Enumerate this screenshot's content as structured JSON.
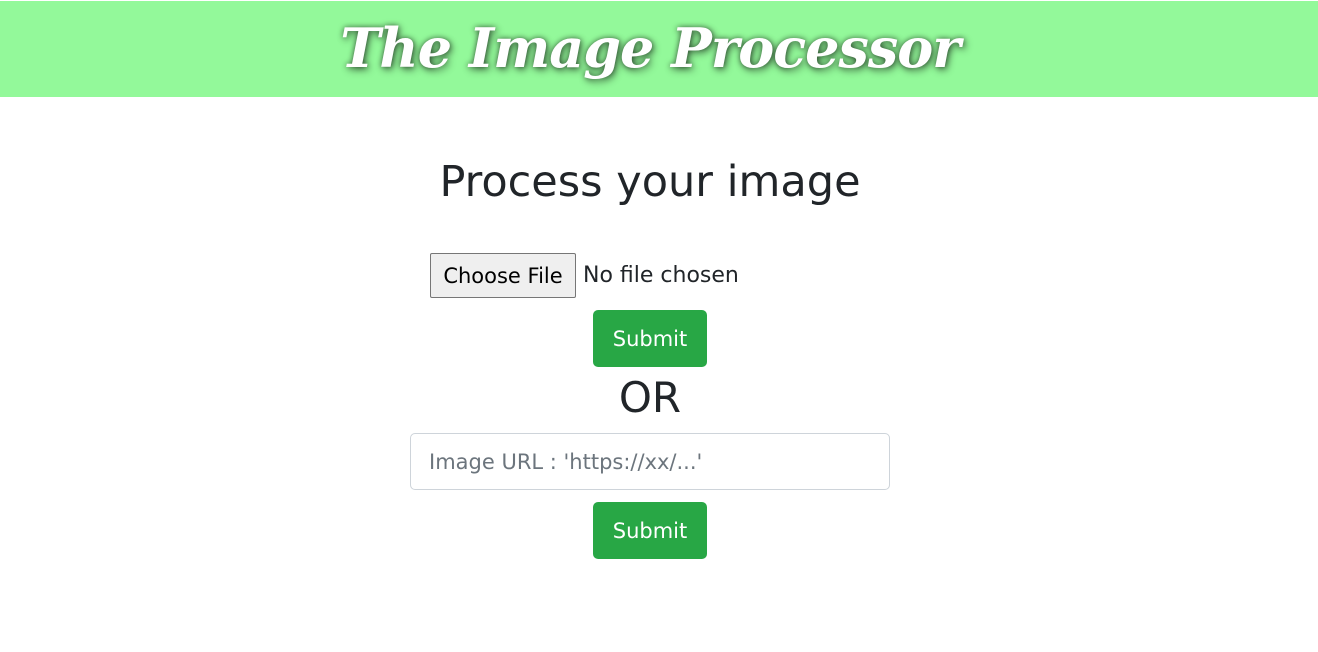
{
  "header": {
    "title": "The Image Processor",
    "background_color": "#93f99a"
  },
  "main": {
    "heading": "Process your image",
    "file_upload": {
      "button_label": "Choose File",
      "status_text": "No file chosen"
    },
    "file_submit_label": "Submit",
    "or_label": "OR",
    "url_input": {
      "value": "",
      "placeholder": "Image URL : 'https://xx/...'"
    },
    "url_submit_label": "Submit",
    "accent_color": "#28a745"
  }
}
